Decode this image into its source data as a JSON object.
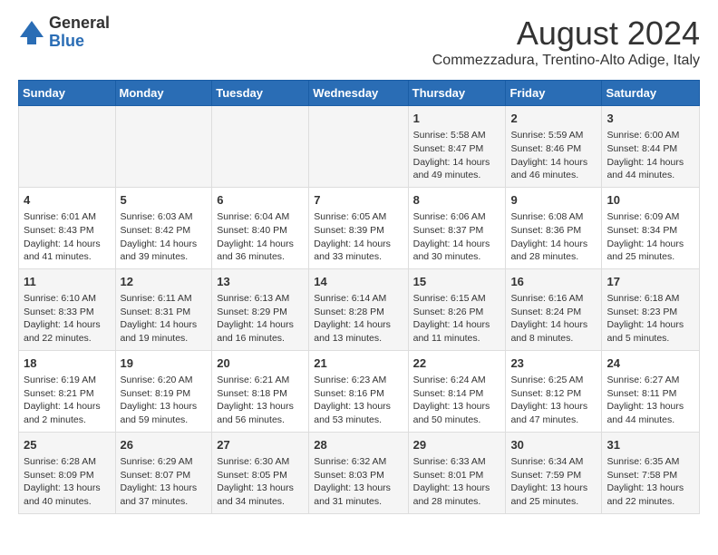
{
  "header": {
    "logo_general": "General",
    "logo_blue": "Blue",
    "month_year": "August 2024",
    "location": "Commezzadura, Trentino-Alto Adige, Italy"
  },
  "days_of_week": [
    "Sunday",
    "Monday",
    "Tuesday",
    "Wednesday",
    "Thursday",
    "Friday",
    "Saturday"
  ],
  "weeks": [
    [
      {
        "day": "",
        "info": ""
      },
      {
        "day": "",
        "info": ""
      },
      {
        "day": "",
        "info": ""
      },
      {
        "day": "",
        "info": ""
      },
      {
        "day": "1",
        "info": "Sunrise: 5:58 AM\nSunset: 8:47 PM\nDaylight: 14 hours and 49 minutes."
      },
      {
        "day": "2",
        "info": "Sunrise: 5:59 AM\nSunset: 8:46 PM\nDaylight: 14 hours and 46 minutes."
      },
      {
        "day": "3",
        "info": "Sunrise: 6:00 AM\nSunset: 8:44 PM\nDaylight: 14 hours and 44 minutes."
      }
    ],
    [
      {
        "day": "4",
        "info": "Sunrise: 6:01 AM\nSunset: 8:43 PM\nDaylight: 14 hours and 41 minutes."
      },
      {
        "day": "5",
        "info": "Sunrise: 6:03 AM\nSunset: 8:42 PM\nDaylight: 14 hours and 39 minutes."
      },
      {
        "day": "6",
        "info": "Sunrise: 6:04 AM\nSunset: 8:40 PM\nDaylight: 14 hours and 36 minutes."
      },
      {
        "day": "7",
        "info": "Sunrise: 6:05 AM\nSunset: 8:39 PM\nDaylight: 14 hours and 33 minutes."
      },
      {
        "day": "8",
        "info": "Sunrise: 6:06 AM\nSunset: 8:37 PM\nDaylight: 14 hours and 30 minutes."
      },
      {
        "day": "9",
        "info": "Sunrise: 6:08 AM\nSunset: 8:36 PM\nDaylight: 14 hours and 28 minutes."
      },
      {
        "day": "10",
        "info": "Sunrise: 6:09 AM\nSunset: 8:34 PM\nDaylight: 14 hours and 25 minutes."
      }
    ],
    [
      {
        "day": "11",
        "info": "Sunrise: 6:10 AM\nSunset: 8:33 PM\nDaylight: 14 hours and 22 minutes."
      },
      {
        "day": "12",
        "info": "Sunrise: 6:11 AM\nSunset: 8:31 PM\nDaylight: 14 hours and 19 minutes."
      },
      {
        "day": "13",
        "info": "Sunrise: 6:13 AM\nSunset: 8:29 PM\nDaylight: 14 hours and 16 minutes."
      },
      {
        "day": "14",
        "info": "Sunrise: 6:14 AM\nSunset: 8:28 PM\nDaylight: 14 hours and 13 minutes."
      },
      {
        "day": "15",
        "info": "Sunrise: 6:15 AM\nSunset: 8:26 PM\nDaylight: 14 hours and 11 minutes."
      },
      {
        "day": "16",
        "info": "Sunrise: 6:16 AM\nSunset: 8:24 PM\nDaylight: 14 hours and 8 minutes."
      },
      {
        "day": "17",
        "info": "Sunrise: 6:18 AM\nSunset: 8:23 PM\nDaylight: 14 hours and 5 minutes."
      }
    ],
    [
      {
        "day": "18",
        "info": "Sunrise: 6:19 AM\nSunset: 8:21 PM\nDaylight: 14 hours and 2 minutes."
      },
      {
        "day": "19",
        "info": "Sunrise: 6:20 AM\nSunset: 8:19 PM\nDaylight: 13 hours and 59 minutes."
      },
      {
        "day": "20",
        "info": "Sunrise: 6:21 AM\nSunset: 8:18 PM\nDaylight: 13 hours and 56 minutes."
      },
      {
        "day": "21",
        "info": "Sunrise: 6:23 AM\nSunset: 8:16 PM\nDaylight: 13 hours and 53 minutes."
      },
      {
        "day": "22",
        "info": "Sunrise: 6:24 AM\nSunset: 8:14 PM\nDaylight: 13 hours and 50 minutes."
      },
      {
        "day": "23",
        "info": "Sunrise: 6:25 AM\nSunset: 8:12 PM\nDaylight: 13 hours and 47 minutes."
      },
      {
        "day": "24",
        "info": "Sunrise: 6:27 AM\nSunset: 8:11 PM\nDaylight: 13 hours and 44 minutes."
      }
    ],
    [
      {
        "day": "25",
        "info": "Sunrise: 6:28 AM\nSunset: 8:09 PM\nDaylight: 13 hours and 40 minutes."
      },
      {
        "day": "26",
        "info": "Sunrise: 6:29 AM\nSunset: 8:07 PM\nDaylight: 13 hours and 37 minutes."
      },
      {
        "day": "27",
        "info": "Sunrise: 6:30 AM\nSunset: 8:05 PM\nDaylight: 13 hours and 34 minutes."
      },
      {
        "day": "28",
        "info": "Sunrise: 6:32 AM\nSunset: 8:03 PM\nDaylight: 13 hours and 31 minutes."
      },
      {
        "day": "29",
        "info": "Sunrise: 6:33 AM\nSunset: 8:01 PM\nDaylight: 13 hours and 28 minutes."
      },
      {
        "day": "30",
        "info": "Sunrise: 6:34 AM\nSunset: 7:59 PM\nDaylight: 13 hours and 25 minutes."
      },
      {
        "day": "31",
        "info": "Sunrise: 6:35 AM\nSunset: 7:58 PM\nDaylight: 13 hours and 22 minutes."
      }
    ]
  ]
}
